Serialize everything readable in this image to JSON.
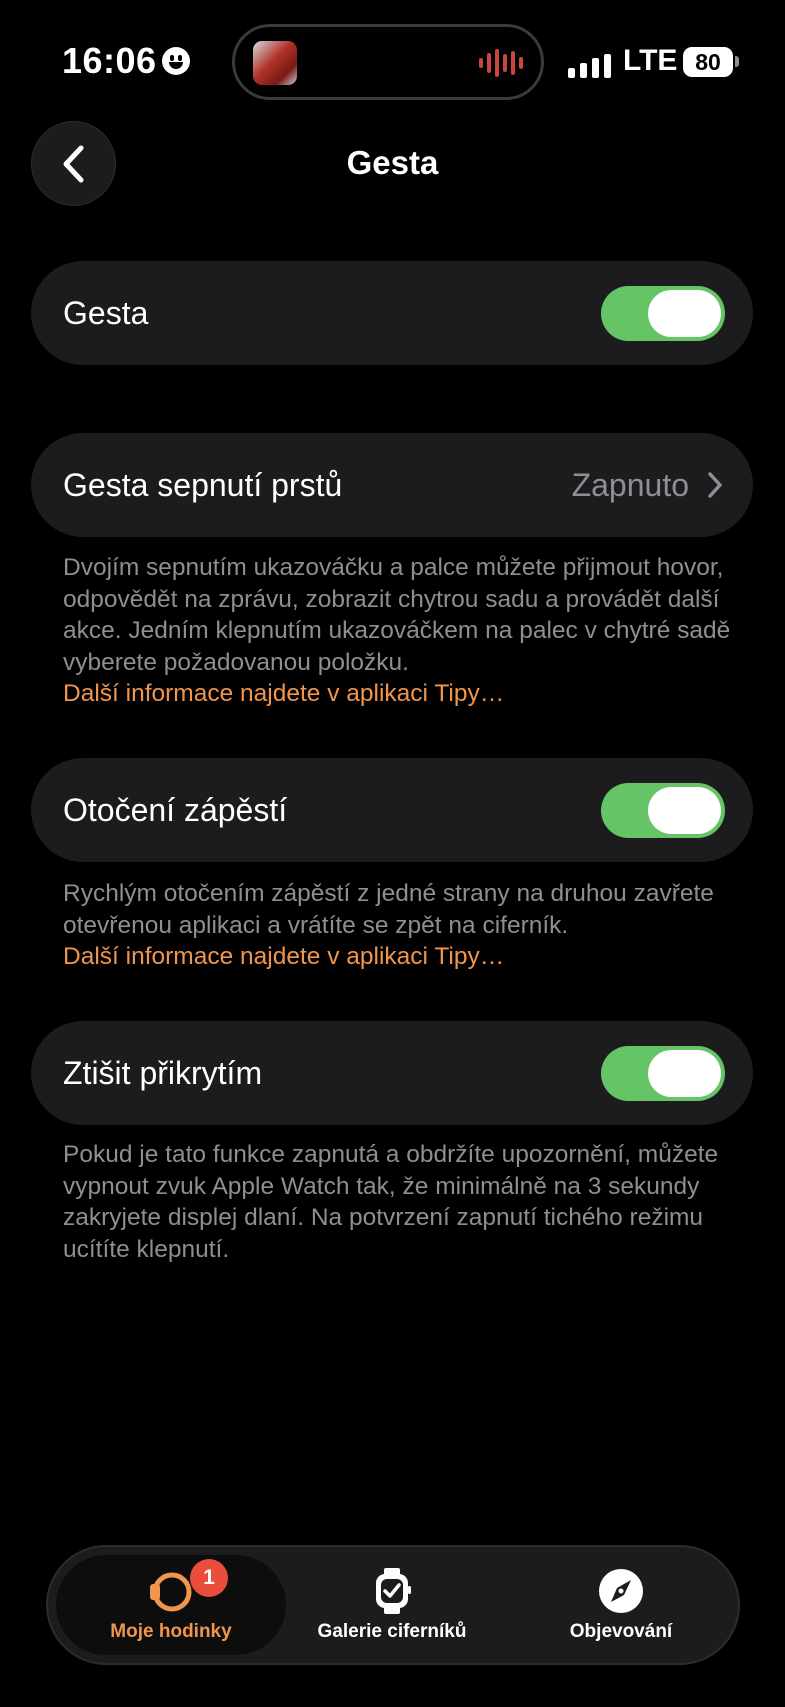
{
  "status_bar": {
    "time": "16:06",
    "network": "LTE",
    "battery": "80"
  },
  "nav": {
    "title": "Gesta"
  },
  "settings": {
    "gestures": {
      "label": "Gesta",
      "enabled": true
    },
    "pinch": {
      "label": "Gesta sepnutí prstů",
      "value": "Zapnuto",
      "description": "Dvojím sepnutím ukazováčku a palce můžete přijmout hovor, odpovědět na zprávu, zobrazit chytrou sadu a provádět další akce. Jedním klepnutím ukazováčkem na palec v chytré sadě vyberete požadovanou položku.",
      "link": "Další informace najdete v aplikaci Tipy…"
    },
    "wrist_flick": {
      "label": "Otočení zápěstí",
      "enabled": true,
      "description": "Rychlým otočením zápěstí z jedné strany na druhou zavřete otevřenou aplikaci a vrátíte se zpět na ciferník.",
      "link": "Další informace najdete v aplikaci Tipy…"
    },
    "cover_to_mute": {
      "label": "Ztišit přikrytím",
      "enabled": true,
      "description": "Pokud je tato funkce zapnutá a obdržíte upozornění, můžete vypnout zvuk Apple Watch tak, že minimálně na 3 sekundy zakryjete displej dlaní. Na potvrzení zapnutí tichého režimu ucítíte klepnutí."
    }
  },
  "tabbar": {
    "tabs": [
      {
        "label": "Moje hodinky",
        "icon": "watch-icon",
        "badge": "1",
        "active": true
      },
      {
        "label": "Galerie ciferníků",
        "icon": "watch-face-gallery-icon",
        "active": false
      },
      {
        "label": "Objevování",
        "icon": "compass-icon",
        "active": false
      }
    ]
  },
  "colors": {
    "accent": "#f0954b",
    "toggle_on": "#65c466",
    "badge": "#eb4d3d",
    "card_bg": "#1c1c1e",
    "secondary_text": "#8e8e93"
  }
}
